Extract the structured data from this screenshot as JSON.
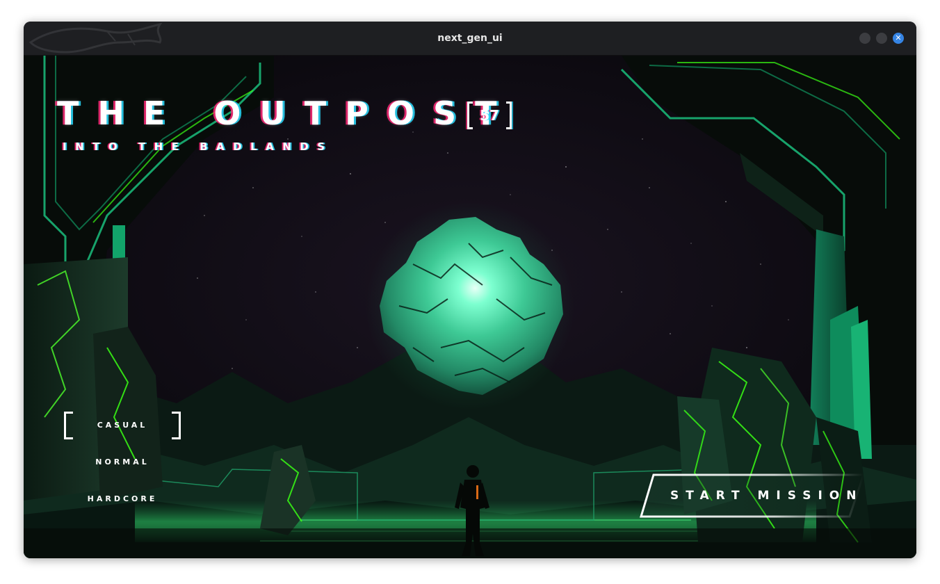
{
  "window": {
    "title": "next_gen_ui"
  },
  "game": {
    "title": "THE OUTPOST",
    "badge": "57",
    "subtitle": "INTO THE BADLANDS"
  },
  "difficulty": {
    "options": [
      "CASUAL",
      "NORMAL",
      "HARDCORE"
    ],
    "selected": "CASUAL"
  },
  "actions": {
    "start_label": "START MISSION"
  },
  "colors": {
    "accent_green": "#2ee58f",
    "neon_green": "#39ff14",
    "sky": "#0d0a10",
    "titlebar": "#1e1f22",
    "close_button": "#3584e4"
  }
}
